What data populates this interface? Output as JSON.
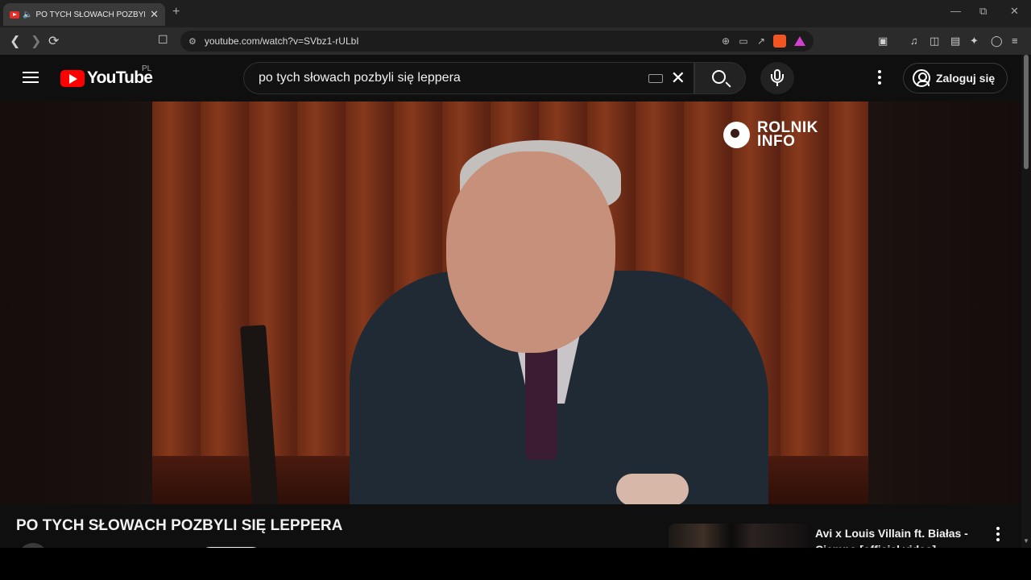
{
  "browser": {
    "tab_title": "PO TYCH SŁOWACH POZBYLI",
    "tab_audio_icon": "speaker-icon",
    "url": "youtube.com/watch?v=SVbz1-rULbI"
  },
  "youtube": {
    "logo_text": "YouTube",
    "country_code": "PL",
    "search_query": "po tych słowach pozbyli się leppera",
    "signin_label": "Zaloguj się"
  },
  "video": {
    "watermark_line1": "ROLNIK",
    "watermark_line2": "INFO",
    "title": "PO TYCH SŁOWACH POZBYLI SIĘ LEPPERA"
  },
  "related": [
    {
      "title": "Avi x Louis Villain ft. Białas - Ciemno [official video]"
    }
  ],
  "colors": {
    "brand": "#ff0000",
    "background": "#0f0f0f",
    "text": "#f1f1f1"
  }
}
